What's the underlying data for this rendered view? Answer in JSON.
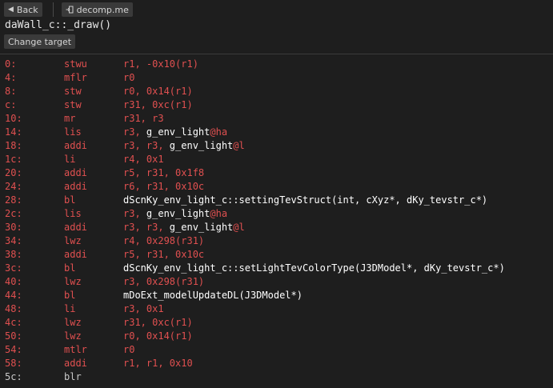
{
  "toolbar": {
    "back_label": "Back",
    "back_icon": "triangle-left-icon",
    "decomp_label": "decomp.me",
    "decomp_icon": "open-in-icon"
  },
  "function_title": "daWall_c::_draw()",
  "change_target_label": "Change target",
  "colors": {
    "background": "#1e1e1e",
    "changed": "#e05050",
    "symbol": "#ffffff",
    "neutral": "#c8c8c8"
  },
  "instructions": [
    {
      "addr": "0:",
      "mnemonic": "stwu",
      "operands": [
        {
          "t": "r1, -0x10(r1)"
        }
      ],
      "changed": true
    },
    {
      "addr": "4:",
      "mnemonic": "mflr",
      "operands": [
        {
          "t": "r0"
        }
      ],
      "changed": true
    },
    {
      "addr": "8:",
      "mnemonic": "stw",
      "operands": [
        {
          "t": "r0, 0x14(r1)"
        }
      ],
      "changed": true
    },
    {
      "addr": "c:",
      "mnemonic": "stw",
      "operands": [
        {
          "t": "r31, 0xc(r1)"
        }
      ],
      "changed": true
    },
    {
      "addr": "10:",
      "mnemonic": "mr",
      "operands": [
        {
          "t": "r31, r3"
        }
      ],
      "changed": true
    },
    {
      "addr": "14:",
      "mnemonic": "lis",
      "operands": [
        {
          "t": "r3, "
        },
        {
          "t": "g_env_light",
          "k": "sym"
        },
        {
          "t": "@ha",
          "k": "reloc"
        }
      ],
      "changed": true
    },
    {
      "addr": "18:",
      "mnemonic": "addi",
      "operands": [
        {
          "t": "r3, r3, "
        },
        {
          "t": "g_env_light",
          "k": "sym"
        },
        {
          "t": "@l",
          "k": "reloc"
        }
      ],
      "changed": true
    },
    {
      "addr": "1c:",
      "mnemonic": "li",
      "operands": [
        {
          "t": "r4, 0x1"
        }
      ],
      "changed": true
    },
    {
      "addr": "20:",
      "mnemonic": "addi",
      "operands": [
        {
          "t": "r5, r31, 0x1f8"
        }
      ],
      "changed": true
    },
    {
      "addr": "24:",
      "mnemonic": "addi",
      "operands": [
        {
          "t": "r6, r31, 0x10c"
        }
      ],
      "changed": true
    },
    {
      "addr": "28:",
      "mnemonic": "bl",
      "operands": [
        {
          "t": "dScnKy_env_light_c::settingTevStruct(int, cXyz*, dKy_tevstr_c*)",
          "k": "sym"
        }
      ],
      "changed": true
    },
    {
      "addr": "2c:",
      "mnemonic": "lis",
      "operands": [
        {
          "t": "r3, "
        },
        {
          "t": "g_env_light",
          "k": "sym"
        },
        {
          "t": "@ha",
          "k": "reloc"
        }
      ],
      "changed": true
    },
    {
      "addr": "30:",
      "mnemonic": "addi",
      "operands": [
        {
          "t": "r3, r3, "
        },
        {
          "t": "g_env_light",
          "k": "sym"
        },
        {
          "t": "@l",
          "k": "reloc"
        }
      ],
      "changed": true
    },
    {
      "addr": "34:",
      "mnemonic": "lwz",
      "operands": [
        {
          "t": "r4, 0x298(r31)"
        }
      ],
      "changed": true
    },
    {
      "addr": "38:",
      "mnemonic": "addi",
      "operands": [
        {
          "t": "r5, r31, 0x10c"
        }
      ],
      "changed": true
    },
    {
      "addr": "3c:",
      "mnemonic": "bl",
      "operands": [
        {
          "t": "dScnKy_env_light_c::setLightTevColorType(J3DModel*, dKy_tevstr_c*)",
          "k": "sym"
        }
      ],
      "changed": true
    },
    {
      "addr": "40:",
      "mnemonic": "lwz",
      "operands": [
        {
          "t": "r3, 0x298(r31)"
        }
      ],
      "changed": true
    },
    {
      "addr": "44:",
      "mnemonic": "bl",
      "operands": [
        {
          "t": "mDoExt_modelUpdateDL(J3DModel*)",
          "k": "sym"
        }
      ],
      "changed": true
    },
    {
      "addr": "48:",
      "mnemonic": "li",
      "operands": [
        {
          "t": "r3, 0x1"
        }
      ],
      "changed": true
    },
    {
      "addr": "4c:",
      "mnemonic": "lwz",
      "operands": [
        {
          "t": "r31, 0xc(r1)"
        }
      ],
      "changed": true
    },
    {
      "addr": "50:",
      "mnemonic": "lwz",
      "operands": [
        {
          "t": "r0, 0x14(r1)"
        }
      ],
      "changed": true
    },
    {
      "addr": "54:",
      "mnemonic": "mtlr",
      "operands": [
        {
          "t": "r0"
        }
      ],
      "changed": true
    },
    {
      "addr": "58:",
      "mnemonic": "addi",
      "operands": [
        {
          "t": "r1, r1, 0x10"
        }
      ],
      "changed": true
    },
    {
      "addr": "5c:",
      "mnemonic": "blr",
      "operands": [],
      "changed": false
    }
  ]
}
